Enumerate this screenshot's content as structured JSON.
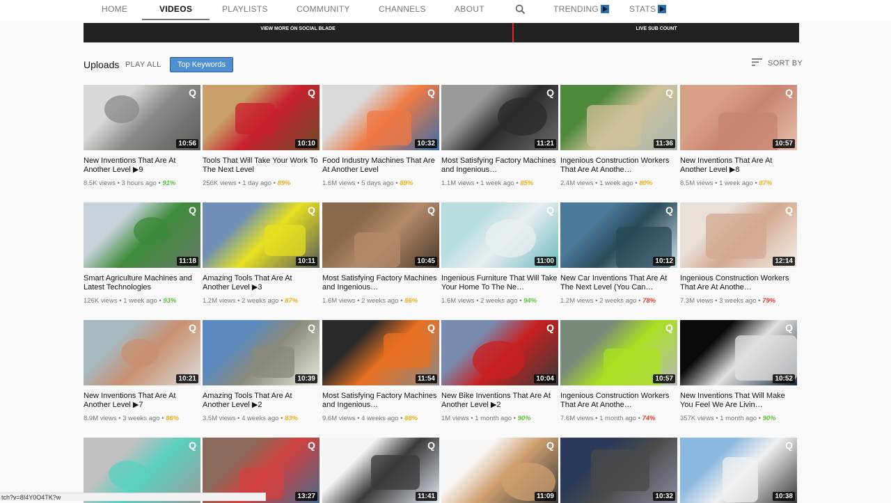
{
  "nav": {
    "items": [
      "HOME",
      "VIDEOS",
      "PLAYLISTS",
      "COMMUNITY",
      "CHANNELS",
      "ABOUT"
    ],
    "trending": "TRENDING",
    "stats": "STATS",
    "search_icon": "search-icon",
    "play_icon": "play-square-icon"
  },
  "banner": {
    "left": "VIEW MORE ON SOCIAL BLADE",
    "right": "LIVE SUB COUNT",
    "divider_color": "#d32f2f"
  },
  "uploads": {
    "label": "Uploads",
    "play_all": "PLAY ALL",
    "keywords": "Top Keywords",
    "sort_by": "SORT BY"
  },
  "colors": {
    "green": "#5cbf3a",
    "yellow": "#e6b020",
    "red": "#d33c2c"
  },
  "videos": [
    {
      "title": "New Inventions That Are At Another Level ▶9",
      "views": "8.5K views",
      "age": "3 hours ago",
      "pct": "91%",
      "pct_color": "green",
      "duration": "10:56",
      "thumb": [
        "#d8d8d6",
        "#8a8a86",
        "#5a5a58"
      ],
      "q": true
    },
    {
      "title": "Tools That Will Take Your Work To The Next Level",
      "views": "256K views",
      "age": "1 day ago",
      "pct": "89%",
      "pct_color": "yellow",
      "duration": "10:10",
      "thumb": [
        "#c9a06a",
        "#c8202c",
        "#6b4a2a"
      ],
      "q": true
    },
    {
      "title": "Food Industry Machines That Are At Another Level",
      "views": "1.6M views",
      "age": "5 days ago",
      "pct": "88%",
      "pct_color": "yellow",
      "duration": "10:32",
      "thumb": [
        "#d9d9d9",
        "#ef7a45",
        "#3a6ea8"
      ],
      "q": true
    },
    {
      "title": "Most Satisfying Factory Machines and Ingenious…",
      "views": "1.1M views",
      "age": "1 week ago",
      "pct": "85%",
      "pct_color": "yellow",
      "duration": "11:21",
      "thumb": [
        "#9a9a9a",
        "#2b2b2b",
        "#6a6a6a"
      ],
      "q": true
    },
    {
      "title": "Ingenious Construction Workers That Are At Anothe…",
      "views": "2.4M views",
      "age": "1 week ago",
      "pct": "80%",
      "pct_color": "yellow",
      "duration": "11:36",
      "thumb": [
        "#4f8a3c",
        "#cfc09a",
        "#a7b8b0"
      ],
      "q": true
    },
    {
      "title": "New Inventions That Are At Another Level ▶8",
      "views": "8.5M views",
      "age": "1 week ago",
      "pct": "87%",
      "pct_color": "yellow",
      "duration": "10:57",
      "thumb": [
        "#d9a088",
        "#c78470",
        "#e8c0b0"
      ],
      "q": true
    },
    {
      "title": "Smart Agriculture Machines and Latest Technologies",
      "views": "126K views",
      "age": "1 week ago",
      "pct": "93%",
      "pct_color": "green",
      "duration": "11:18",
      "thumb": [
        "#c7d2da",
        "#3d8a3a",
        "#6a7a6a"
      ],
      "q": true
    },
    {
      "title": "Amazing Tools That Are At Another Level ▶3",
      "views": "1.2M views",
      "age": "2 weeks ago",
      "pct": "87%",
      "pct_color": "yellow",
      "duration": "10:11",
      "thumb": [
        "#6f8fb8",
        "#e6e020",
        "#5a5a5a"
      ],
      "q": true
    },
    {
      "title": "Most Satisfying Factory Machines and Ingenious…",
      "views": "1.6M views",
      "age": "2 weeks ago",
      "pct": "86%",
      "pct_color": "yellow",
      "duration": "10:45",
      "thumb": [
        "#8a6a4a",
        "#b48a6a",
        "#4a3a2a"
      ],
      "q": true
    },
    {
      "title": "Ingenious Furniture That Will Take Your Home To The Ne…",
      "views": "1.6M views",
      "age": "2 weeks ago",
      "pct": "94%",
      "pct_color": "green",
      "duration": "11:00",
      "thumb": [
        "#b8dde0",
        "#e8eef0",
        "#6ab8c0"
      ],
      "q": true
    },
    {
      "title": "New Car Inventions That Are At The Next Level (You Can…",
      "views": "1.2M views",
      "age": "2 weeks ago",
      "pct": "78%",
      "pct_color": "red",
      "duration": "10:12",
      "thumb": [
        "#4a7a9a",
        "#2a4a5a",
        "#d0e0e8"
      ],
      "q": true
    },
    {
      "title": "Ingenious Construction Workers That Are At Anothe…",
      "views": "7.3M views",
      "age": "3 weeks ago",
      "pct": "79%",
      "pct_color": "red",
      "duration": "12:14",
      "thumb": [
        "#e8e0d8",
        "#d4a890",
        "#f4f0ea"
      ],
      "q": true
    },
    {
      "title": "New Inventions That Are At Another Level ▶7",
      "views": "8.9M views",
      "age": "3 weeks ago",
      "pct": "86%",
      "pct_color": "yellow",
      "duration": "10:21",
      "thumb": [
        "#a8b8c0",
        "#c89070",
        "#dcdcdc"
      ],
      "q": true
    },
    {
      "title": "Amazing Tools That Are At Another Level ▶2",
      "views": "3.5M views",
      "age": "4 weeks ago",
      "pct": "83%",
      "pct_color": "yellow",
      "duration": "10:39",
      "thumb": [
        "#5a8ac0",
        "#8a8a7a",
        "#e8e8e0"
      ],
      "q": true
    },
    {
      "title": "Most Satisfying Factory Machines and Ingenious…",
      "views": "9.6M views",
      "age": "4 weeks ago",
      "pct": "88%",
      "pct_color": "yellow",
      "duration": "11:54",
      "thumb": [
        "#2a2a2a",
        "#e87020",
        "#8a8a8a"
      ],
      "q": true
    },
    {
      "title": "New Bike Inventions That Are At Another Level ▶2",
      "views": "1M views",
      "age": "1 month ago",
      "pct": "90%",
      "pct_color": "green",
      "duration": "10:04",
      "thumb": [
        "#7a8ab0",
        "#c82020",
        "#3a3a3a"
      ],
      "q": true
    },
    {
      "title": "Ingenious Construction Workers That Are At Anothe…",
      "views": "7.6M views",
      "age": "1 month ago",
      "pct": "74%",
      "pct_color": "red",
      "duration": "10:57",
      "thumb": [
        "#7a8a7a",
        "#a8e020",
        "#b8b8b8"
      ],
      "q": true
    },
    {
      "title": "New Inventions That Will Make You Feel We Are Livin…",
      "views": "357K views",
      "age": "1 month ago",
      "pct": "90%",
      "pct_color": "green",
      "duration": "10:52",
      "thumb": [
        "#0a0a0a",
        "#e0e0e0",
        "#1a2a3a"
      ],
      "q": true
    },
    {
      "title": "",
      "views": "",
      "age": "",
      "pct": "",
      "pct_color": "green",
      "duration": "",
      "thumb": [
        "#c0c0c0",
        "#5ad0c0",
        "#9a9a9a"
      ],
      "q": true
    },
    {
      "title": "",
      "views": "",
      "age": "",
      "pct": "",
      "pct_color": "green",
      "duration": "13:27",
      "thumb": [
        "#8a6a5a",
        "#d04040",
        "#4a6a8a"
      ],
      "q": true
    },
    {
      "title": "",
      "views": "",
      "age": "",
      "pct": "",
      "pct_color": "green",
      "duration": "11:41",
      "thumb": [
        "#f4f4f4",
        "#3a3a3a",
        "#e0e8f0"
      ],
      "q": true
    },
    {
      "title": "",
      "views": "",
      "age": "",
      "pct": "",
      "pct_color": "green",
      "duration": "11:09",
      "thumb": [
        "#f8f8f8",
        "#d0a070",
        "#3a3a3a"
      ],
      "q": true
    },
    {
      "title": "",
      "views": "",
      "age": "",
      "pct": "",
      "pct_color": "green",
      "duration": "10:32",
      "thumb": [
        "#2a3a5a",
        "#4a4a4a",
        "#8a8aa0"
      ],
      "q": false
    },
    {
      "title": "",
      "views": "",
      "age": "",
      "pct": "",
      "pct_color": "green",
      "duration": "10:38",
      "thumb": [
        "#8ab8e0",
        "#f0f0f0",
        "#3a3a3a"
      ],
      "q": true
    }
  ],
  "status_url": "tch?v=8I4Y0O4TK?w"
}
